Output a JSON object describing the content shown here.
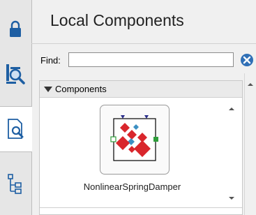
{
  "title": "Local Components",
  "find": {
    "label": "Find:",
    "value": "",
    "placeholder": ""
  },
  "section": {
    "label": "Components"
  },
  "components": [
    {
      "name": "NonlinearSpringDamper"
    }
  ],
  "side_tabs": [
    {
      "icon": "lock-icon",
      "active": false
    },
    {
      "icon": "library-search-icon",
      "active": false
    },
    {
      "icon": "document-search-icon",
      "active": true
    },
    {
      "icon": "tree-structure-icon",
      "active": false
    }
  ],
  "colors": {
    "accent": "#1e5fa3",
    "clear_button": "#2f6fb6",
    "diamond_red": "#d9262c",
    "diamond_blue": "#3b8fc2",
    "port_navy": "#2a2f8c",
    "port_green": "#2f9e3b"
  }
}
